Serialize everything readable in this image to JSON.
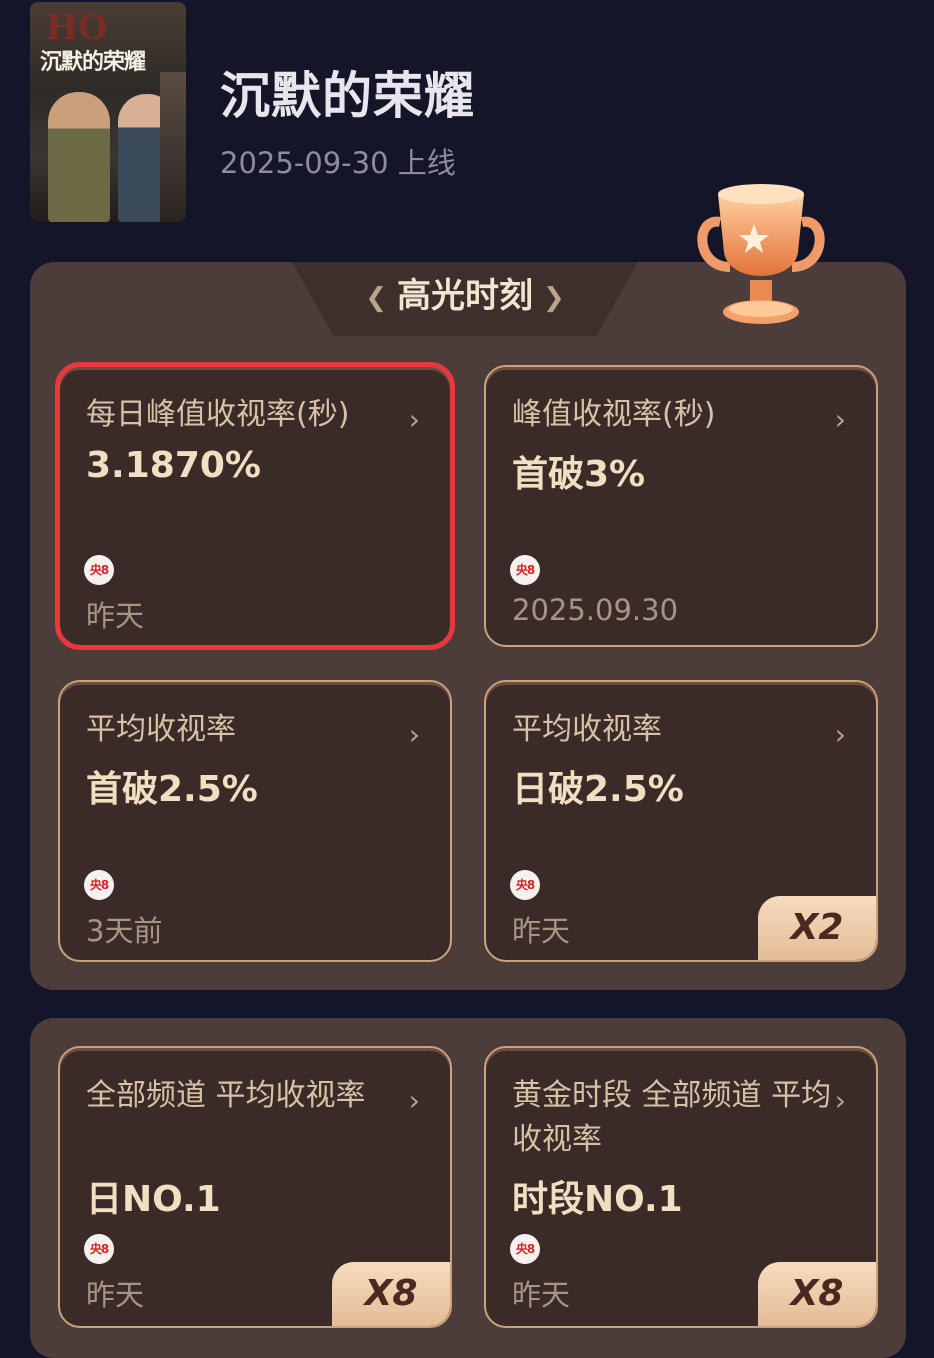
{
  "poster": {
    "title": "沉默的荣耀",
    "bg_letters": "HO"
  },
  "header": {
    "title": "沉默的荣耀",
    "release": "2025-09-30 上线"
  },
  "highlight": {
    "tab_title": "高光时刻"
  },
  "channel_badge": "央8",
  "cards": [
    {
      "label": "每日峰值收视率(秒)",
      "value": "3.1870%",
      "time": "昨天",
      "multiplier": ""
    },
    {
      "label": "峰值收视率(秒)",
      "value": "首破3%",
      "time": "2025.09.30",
      "multiplier": ""
    },
    {
      "label": "平均收视率",
      "value": "首破2.5%",
      "time": "3天前",
      "multiplier": ""
    },
    {
      "label": "平均收视率",
      "value": "日破2.5%",
      "time": "昨天",
      "multiplier": "X2"
    },
    {
      "label": "全部频道 平均收视率",
      "value": "日NO.1",
      "time": "昨天",
      "multiplier": "X8"
    },
    {
      "label": "黄金时段 全部频道 平均收视率",
      "value": "时段NO.1",
      "time": "昨天",
      "multiplier": "X8"
    }
  ],
  "colors": {
    "background": "#15152a",
    "panel": "#4d3d3a",
    "card": "#3a2b29",
    "border": "#c9a27e",
    "selection": "#e8383c"
  }
}
